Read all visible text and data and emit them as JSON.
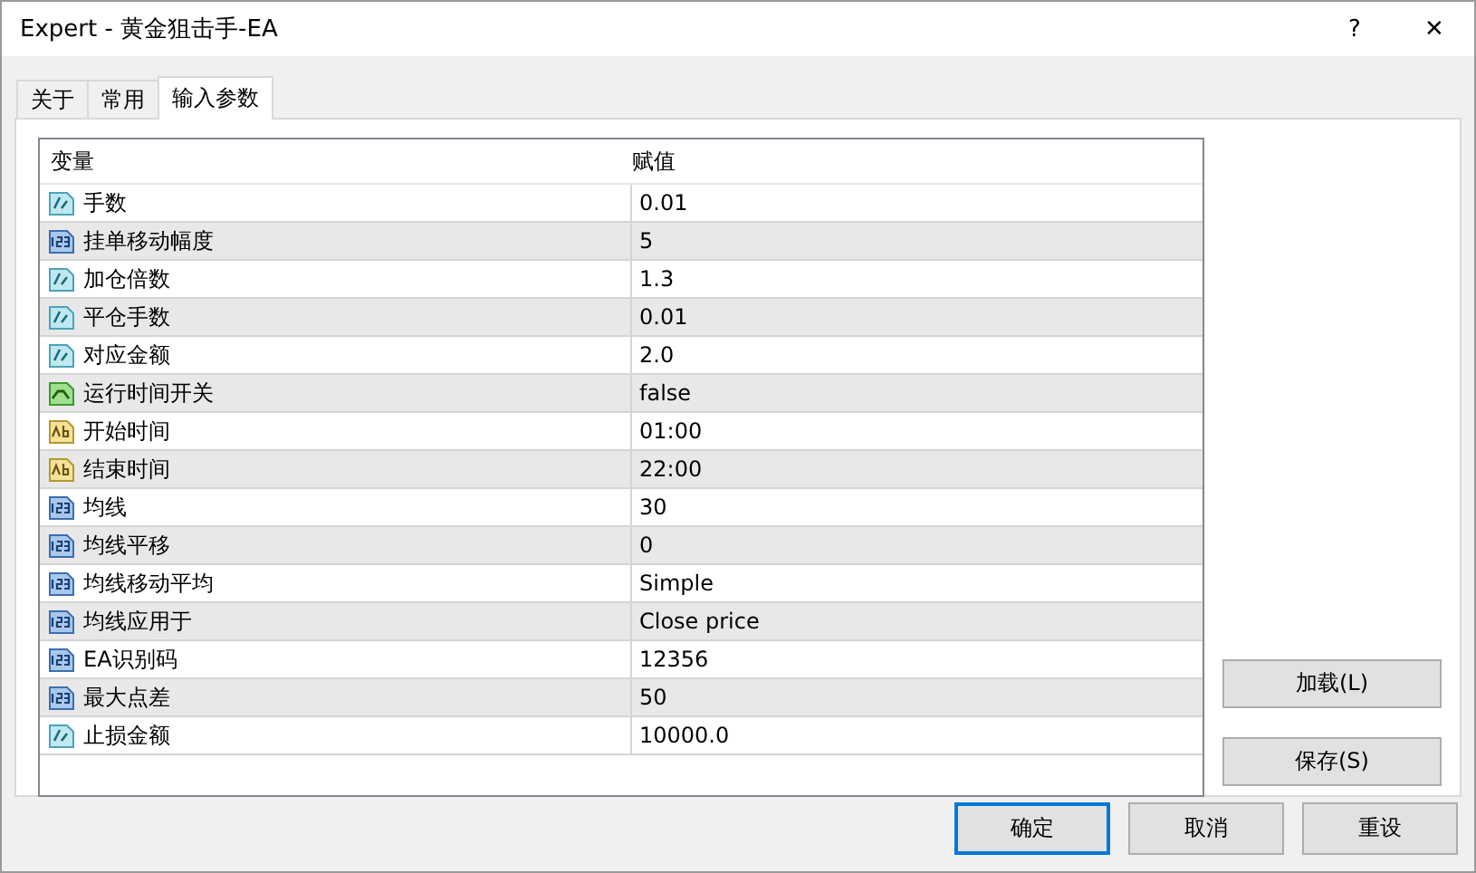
{
  "window": {
    "title": "Expert - 黄金狙击手-EA",
    "help": "?",
    "close": "✕"
  },
  "tabs": [
    {
      "label": "关于",
      "selected": false
    },
    {
      "label": "常用",
      "selected": false
    },
    {
      "label": "输入参数",
      "selected": true
    }
  ],
  "table": {
    "columns": [
      "变量",
      "赋值"
    ],
    "rows": [
      {
        "kind": "double",
        "name": "手数",
        "value": "0.01"
      },
      {
        "kind": "int",
        "name": "挂单移动幅度",
        "value": "5"
      },
      {
        "kind": "double",
        "name": "加仓倍数",
        "value": "1.3"
      },
      {
        "kind": "double",
        "name": "平仓手数",
        "value": "0.01"
      },
      {
        "kind": "double",
        "name": "对应金额",
        "value": "2.0"
      },
      {
        "kind": "bool",
        "name": "运行时间开关",
        "value": "false"
      },
      {
        "kind": "string",
        "name": "开始时间",
        "value": "01:00"
      },
      {
        "kind": "string",
        "name": "结束时间",
        "value": "22:00"
      },
      {
        "kind": "int",
        "name": "均线",
        "value": "30"
      },
      {
        "kind": "int",
        "name": "均线平移",
        "value": "0"
      },
      {
        "kind": "int",
        "name": "均线移动平均",
        "value": "Simple"
      },
      {
        "kind": "int",
        "name": "均线应用于",
        "value": "Close price"
      },
      {
        "kind": "int",
        "name": "EA识别码",
        "value": "12356"
      },
      {
        "kind": "int",
        "name": "最大点差",
        "value": "50"
      },
      {
        "kind": "double",
        "name": "止损金额",
        "value": "10000.0"
      }
    ]
  },
  "side_buttons": [
    "加载(L)",
    "保存(S)"
  ],
  "buttons": [
    {
      "label": "确定",
      "default": true
    },
    {
      "label": "取消",
      "default": false
    },
    {
      "label": "重设",
      "default": false
    }
  ]
}
